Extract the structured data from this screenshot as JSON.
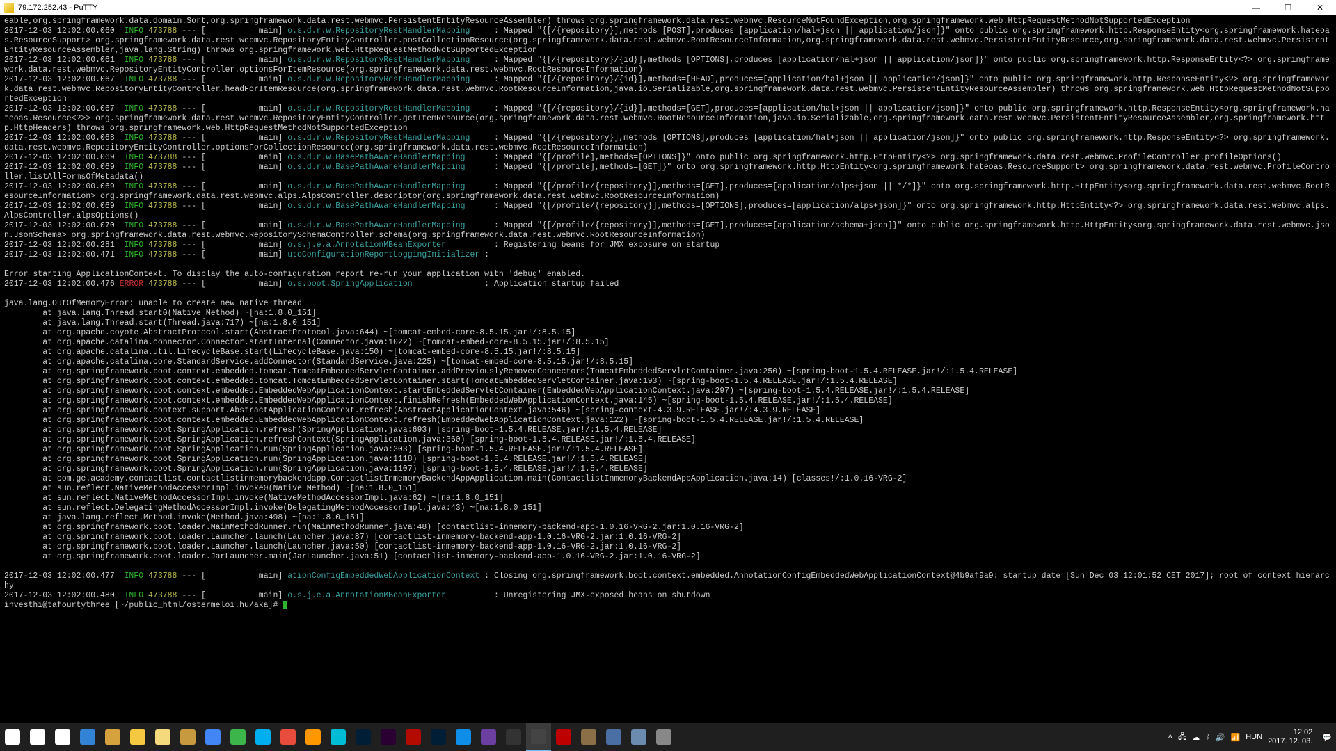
{
  "titlebar": {
    "title": "79.172.252.43 - PuTTY"
  },
  "lines": [
    {
      "parts": [
        {
          "t": "eable,org.springframework.data.domain.Sort,org.springframework.data.rest.webmvc.PersistentEntityResourceAssembler) throws org.springframework.data.rest.webmvc.ResourceNotFoundException,org.springframework.web.HttpRequestMethodNotSupportedException"
        }
      ]
    },
    {
      "parts": [
        {
          "t": "2017-12-03 12:02:00.060  "
        },
        {
          "t": "INFO",
          "c": "green"
        },
        {
          "t": " "
        },
        {
          "t": "473788",
          "c": "yellowish"
        },
        {
          "t": " --- [           main] "
        },
        {
          "t": "o.s.d.r.w.RepositoryRestHandlerMapping",
          "c": "cyan"
        },
        {
          "t": "     : Mapped \"{[/{repository}],methods=[POST],produces=[application/hal+json || application/json]}\" onto public org.springframework.http.ResponseEntity<org.springframework.hateoas.ResourceSupport> org.springframework.data.rest.webmvc.RepositoryEntityController.postCollectionResource(org.springframework.data.rest.webmvc.RootResourceInformation,org.springframework.data.rest.webmvc.PersistentEntityResource,org.springframework.data.rest.webmvc.PersistentEntityResourceAssembler,java.lang.String) throws org.springframework.web.HttpRequestMethodNotSupportedException"
        }
      ]
    },
    {
      "parts": [
        {
          "t": "2017-12-03 12:02:00.061  "
        },
        {
          "t": "INFO",
          "c": "green"
        },
        {
          "t": " "
        },
        {
          "t": "473788",
          "c": "yellowish"
        },
        {
          "t": " --- [           main] "
        },
        {
          "t": "o.s.d.r.w.RepositoryRestHandlerMapping",
          "c": "cyan"
        },
        {
          "t": "     : Mapped \"{[/{repository}/{id}],methods=[OPTIONS],produces=[application/hal+json || application/json]}\" onto public org.springframework.http.ResponseEntity<?> org.springframework.data.rest.webmvc.RepositoryEntityController.optionsForItemResource(org.springframework.data.rest.webmvc.RootResourceInformation)"
        }
      ]
    },
    {
      "parts": [
        {
          "t": "2017-12-03 12:02:00.067  "
        },
        {
          "t": "INFO",
          "c": "green"
        },
        {
          "t": " "
        },
        {
          "t": "473788",
          "c": "yellowish"
        },
        {
          "t": " --- [           main] "
        },
        {
          "t": "o.s.d.r.w.RepositoryRestHandlerMapping",
          "c": "cyan"
        },
        {
          "t": "     : Mapped \"{[/{repository}/{id}],methods=[HEAD],produces=[application/hal+json || application/json]}\" onto public org.springframework.http.ResponseEntity<?> org.springframework.data.rest.webmvc.RepositoryEntityController.headForItemResource(org.springframework.data.rest.webmvc.RootResourceInformation,java.io.Serializable,org.springframework.data.rest.webmvc.PersistentEntityResourceAssembler) throws org.springframework.web.HttpRequestMethodNotSupportedException"
        }
      ]
    },
    {
      "parts": [
        {
          "t": "2017-12-03 12:02:00.067  "
        },
        {
          "t": "INFO",
          "c": "green"
        },
        {
          "t": " "
        },
        {
          "t": "473788",
          "c": "yellowish"
        },
        {
          "t": " --- [           main] "
        },
        {
          "t": "o.s.d.r.w.RepositoryRestHandlerMapping",
          "c": "cyan"
        },
        {
          "t": "     : Mapped \"{[/{repository}/{id}],methods=[GET],produces=[application/hal+json || application/json]}\" onto public org.springframework.http.ResponseEntity<org.springframework.hateoas.Resource<?>> org.springframework.data.rest.webmvc.RepositoryEntityController.getItemResource(org.springframework.data.rest.webmvc.RootResourceInformation,java.io.Serializable,org.springframework.data.rest.webmvc.PersistentEntityResourceAssembler,org.springframework.http.HttpHeaders) throws org.springframework.web.HttpRequestMethodNotSupportedException"
        }
      ]
    },
    {
      "parts": [
        {
          "t": "2017-12-03 12:02:00.068  "
        },
        {
          "t": "INFO",
          "c": "green"
        },
        {
          "t": " "
        },
        {
          "t": "473788",
          "c": "yellowish"
        },
        {
          "t": " --- [           main] "
        },
        {
          "t": "o.s.d.r.w.RepositoryRestHandlerMapping",
          "c": "cyan"
        },
        {
          "t": "     : Mapped \"{[/{repository}],methods=[OPTIONS],produces=[application/hal+json || application/json]}\" onto public org.springframework.http.ResponseEntity<?> org.springframework.data.rest.webmvc.RepositoryEntityController.optionsForCollectionResource(org.springframework.data.rest.webmvc.RootResourceInformation)"
        }
      ]
    },
    {
      "parts": [
        {
          "t": "2017-12-03 12:02:00.069  "
        },
        {
          "t": "INFO",
          "c": "green"
        },
        {
          "t": " "
        },
        {
          "t": "473788",
          "c": "yellowish"
        },
        {
          "t": " --- [           main] "
        },
        {
          "t": "o.s.d.r.w.BasePathAwareHandlerMapping",
          "c": "cyan"
        },
        {
          "t": "      : Mapped \"{[/profile],methods=[OPTIONS]}\" onto public org.springframework.http.HttpEntity<?> org.springframework.data.rest.webmvc.ProfileController.profileOptions()"
        }
      ]
    },
    {
      "parts": [
        {
          "t": "2017-12-03 12:02:00.069  "
        },
        {
          "t": "INFO",
          "c": "green"
        },
        {
          "t": " "
        },
        {
          "t": "473788",
          "c": "yellowish"
        },
        {
          "t": " --- [           main] "
        },
        {
          "t": "o.s.d.r.w.BasePathAwareHandlerMapping",
          "c": "cyan"
        },
        {
          "t": "      : Mapped \"{[/profile],methods=[GET]}\" onto org.springframework.http.HttpEntity<org.springframework.hateoas.ResourceSupport> org.springframework.data.rest.webmvc.ProfileController.listAllFormsOfMetadata()"
        }
      ]
    },
    {
      "parts": [
        {
          "t": "2017-12-03 12:02:00.069  "
        },
        {
          "t": "INFO",
          "c": "green"
        },
        {
          "t": " "
        },
        {
          "t": "473788",
          "c": "yellowish"
        },
        {
          "t": " --- [           main] "
        },
        {
          "t": "o.s.d.r.w.BasePathAwareHandlerMapping",
          "c": "cyan"
        },
        {
          "t": "      : Mapped \"{[/profile/{repository}],methods=[GET],produces=[application/alps+json || */*]}\" onto org.springframework.http.HttpEntity<org.springframework.data.rest.webmvc.RootResourceInformation> org.springframework.data.rest.webmvc.alps.AlpsController.descriptor(org.springframework.data.rest.webmvc.RootResourceInformation)"
        }
      ]
    },
    {
      "parts": [
        {
          "t": "2017-12-03 12:02:00.069  "
        },
        {
          "t": "INFO",
          "c": "green"
        },
        {
          "t": " "
        },
        {
          "t": "473788",
          "c": "yellowish"
        },
        {
          "t": " --- [           main] "
        },
        {
          "t": "o.s.d.r.w.BasePathAwareHandlerMapping",
          "c": "cyan"
        },
        {
          "t": "      : Mapped \"{[/profile/{repository}],methods=[OPTIONS],produces=[application/alps+json]}\" onto org.springframework.http.HttpEntity<?> org.springframework.data.rest.webmvc.alps.AlpsController.alpsOptions()"
        }
      ]
    },
    {
      "parts": [
        {
          "t": "2017-12-03 12:02:00.070  "
        },
        {
          "t": "INFO",
          "c": "green"
        },
        {
          "t": " "
        },
        {
          "t": "473788",
          "c": "yellowish"
        },
        {
          "t": " --- [           main] "
        },
        {
          "t": "o.s.d.r.w.BasePathAwareHandlerMapping",
          "c": "cyan"
        },
        {
          "t": "      : Mapped \"{[/profile/{repository}],methods=[GET],produces=[application/schema+json]}\" onto public org.springframework.http.HttpEntity<org.springframework.data.rest.webmvc.json.JsonSchema> org.springframework.data.rest.webmvc.RepositorySchemaController.schema(org.springframework.data.rest.webmvc.RootResourceInformation)"
        }
      ]
    },
    {
      "parts": [
        {
          "t": "2017-12-03 12:02:00.281  "
        },
        {
          "t": "INFO",
          "c": "green"
        },
        {
          "t": " "
        },
        {
          "t": "473788",
          "c": "yellowish"
        },
        {
          "t": " --- [           main] "
        },
        {
          "t": "o.s.j.e.a.AnnotationMBeanExporter",
          "c": "cyan"
        },
        {
          "t": "          : Registering beans for JMX exposure on startup"
        }
      ]
    },
    {
      "parts": [
        {
          "t": "2017-12-03 12:02:00.471  "
        },
        {
          "t": "INFO",
          "c": "green"
        },
        {
          "t": " "
        },
        {
          "t": "473788",
          "c": "yellowish"
        },
        {
          "t": " --- [           main] "
        },
        {
          "t": "utoConfigurationReportLoggingInitializer",
          "c": "cyan"
        },
        {
          "t": " : "
        }
      ]
    },
    {
      "parts": [
        {
          "t": " "
        }
      ]
    },
    {
      "parts": [
        {
          "t": "Error starting ApplicationContext. To display the auto-configuration report re-run your application with 'debug' enabled."
        }
      ]
    },
    {
      "parts": [
        {
          "t": "2017-12-03 12:02:00.476 "
        },
        {
          "t": "ERROR",
          "c": "red"
        },
        {
          "t": " "
        },
        {
          "t": "473788",
          "c": "yellowish"
        },
        {
          "t": " --- [           main] "
        },
        {
          "t": "o.s.boot.SpringApplication",
          "c": "cyan"
        },
        {
          "t": "               : Application startup failed"
        }
      ]
    },
    {
      "parts": [
        {
          "t": " "
        }
      ]
    },
    {
      "parts": [
        {
          "t": "java.lang.OutOfMemoryError: unable to create new native thread"
        }
      ]
    },
    {
      "parts": [
        {
          "t": "        at java.lang.Thread.start0(Native Method) ~[na:1.8.0_151]"
        }
      ]
    },
    {
      "parts": [
        {
          "t": "        at java.lang.Thread.start(Thread.java:717) ~[na:1.8.0_151]"
        }
      ]
    },
    {
      "parts": [
        {
          "t": "        at org.apache.coyote.AbstractProtocol.start(AbstractProtocol.java:644) ~[tomcat-embed-core-8.5.15.jar!/:8.5.15]"
        }
      ]
    },
    {
      "parts": [
        {
          "t": "        at org.apache.catalina.connector.Connector.startInternal(Connector.java:1022) ~[tomcat-embed-core-8.5.15.jar!/:8.5.15]"
        }
      ]
    },
    {
      "parts": [
        {
          "t": "        at org.apache.catalina.util.LifecycleBase.start(LifecycleBase.java:150) ~[tomcat-embed-core-8.5.15.jar!/:8.5.15]"
        }
      ]
    },
    {
      "parts": [
        {
          "t": "        at org.apache.catalina.core.StandardService.addConnector(StandardService.java:225) ~[tomcat-embed-core-8.5.15.jar!/:8.5.15]"
        }
      ]
    },
    {
      "parts": [
        {
          "t": "        at org.springframework.boot.context.embedded.tomcat.TomcatEmbeddedServletContainer.addPreviouslyRemovedConnectors(TomcatEmbeddedServletContainer.java:250) ~[spring-boot-1.5.4.RELEASE.jar!/:1.5.4.RELEASE]"
        }
      ]
    },
    {
      "parts": [
        {
          "t": "        at org.springframework.boot.context.embedded.tomcat.TomcatEmbeddedServletContainer.start(TomcatEmbeddedServletContainer.java:193) ~[spring-boot-1.5.4.RELEASE.jar!/:1.5.4.RELEASE]"
        }
      ]
    },
    {
      "parts": [
        {
          "t": "        at org.springframework.boot.context.embedded.EmbeddedWebApplicationContext.startEmbeddedServletContainer(EmbeddedWebApplicationContext.java:297) ~[spring-boot-1.5.4.RELEASE.jar!/:1.5.4.RELEASE]"
        }
      ]
    },
    {
      "parts": [
        {
          "t": "        at org.springframework.boot.context.embedded.EmbeddedWebApplicationContext.finishRefresh(EmbeddedWebApplicationContext.java:145) ~[spring-boot-1.5.4.RELEASE.jar!/:1.5.4.RELEASE]"
        }
      ]
    },
    {
      "parts": [
        {
          "t": "        at org.springframework.context.support.AbstractApplicationContext.refresh(AbstractApplicationContext.java:546) ~[spring-context-4.3.9.RELEASE.jar!/:4.3.9.RELEASE]"
        }
      ]
    },
    {
      "parts": [
        {
          "t": "        at org.springframework.boot.context.embedded.EmbeddedWebApplicationContext.refresh(EmbeddedWebApplicationContext.java:122) ~[spring-boot-1.5.4.RELEASE.jar!/:1.5.4.RELEASE]"
        }
      ]
    },
    {
      "parts": [
        {
          "t": "        at org.springframework.boot.SpringApplication.refresh(SpringApplication.java:693) [spring-boot-1.5.4.RELEASE.jar!/:1.5.4.RELEASE]"
        }
      ]
    },
    {
      "parts": [
        {
          "t": "        at org.springframework.boot.SpringApplication.refreshContext(SpringApplication.java:360) [spring-boot-1.5.4.RELEASE.jar!/:1.5.4.RELEASE]"
        }
      ]
    },
    {
      "parts": [
        {
          "t": "        at org.springframework.boot.SpringApplication.run(SpringApplication.java:303) [spring-boot-1.5.4.RELEASE.jar!/:1.5.4.RELEASE]"
        }
      ]
    },
    {
      "parts": [
        {
          "t": "        at org.springframework.boot.SpringApplication.run(SpringApplication.java:1118) [spring-boot-1.5.4.RELEASE.jar!/:1.5.4.RELEASE]"
        }
      ]
    },
    {
      "parts": [
        {
          "t": "        at org.springframework.boot.SpringApplication.run(SpringApplication.java:1107) [spring-boot-1.5.4.RELEASE.jar!/:1.5.4.RELEASE]"
        }
      ]
    },
    {
      "parts": [
        {
          "t": "        at com.ge.academy.contactlist.contactlistinmemorybackendapp.ContactlistInmemoryBackendAppApplication.main(ContactlistInmemoryBackendAppApplication.java:14) [classes!/:1.0.16-VRG-2]"
        }
      ]
    },
    {
      "parts": [
        {
          "t": "        at sun.reflect.NativeMethodAccessorImpl.invoke0(Native Method) ~[na:1.8.0_151]"
        }
      ]
    },
    {
      "parts": [
        {
          "t": "        at sun.reflect.NativeMethodAccessorImpl.invoke(NativeMethodAccessorImpl.java:62) ~[na:1.8.0_151]"
        }
      ]
    },
    {
      "parts": [
        {
          "t": "        at sun.reflect.DelegatingMethodAccessorImpl.invoke(DelegatingMethodAccessorImpl.java:43) ~[na:1.8.0_151]"
        }
      ]
    },
    {
      "parts": [
        {
          "t": "        at java.lang.reflect.Method.invoke(Method.java:498) ~[na:1.8.0_151]"
        }
      ]
    },
    {
      "parts": [
        {
          "t": "        at org.springframework.boot.loader.MainMethodRunner.run(MainMethodRunner.java:48) [contactlist-inmemory-backend-app-1.0.16-VRG-2.jar:1.0.16-VRG-2]"
        }
      ]
    },
    {
      "parts": [
        {
          "t": "        at org.springframework.boot.loader.Launcher.launch(Launcher.java:87) [contactlist-inmemory-backend-app-1.0.16-VRG-2.jar:1.0.16-VRG-2]"
        }
      ]
    },
    {
      "parts": [
        {
          "t": "        at org.springframework.boot.loader.Launcher.launch(Launcher.java:50) [contactlist-inmemory-backend-app-1.0.16-VRG-2.jar:1.0.16-VRG-2]"
        }
      ]
    },
    {
      "parts": [
        {
          "t": "        at org.springframework.boot.loader.JarLauncher.main(JarLauncher.java:51) [contactlist-inmemory-backend-app-1.0.16-VRG-2.jar:1.0.16-VRG-2]"
        }
      ]
    },
    {
      "parts": [
        {
          "t": " "
        }
      ]
    },
    {
      "parts": [
        {
          "t": "2017-12-03 12:02:00.477  "
        },
        {
          "t": "INFO",
          "c": "green"
        },
        {
          "t": " "
        },
        {
          "t": "473788",
          "c": "yellowish"
        },
        {
          "t": " --- [           main] "
        },
        {
          "t": "ationConfigEmbeddedWebApplicationContext",
          "c": "cyan"
        },
        {
          "t": " : Closing org.springframework.boot.context.embedded.AnnotationConfigEmbeddedWebApplicationContext@4b9af9a9: startup date [Sun Dec 03 12:01:52 CET 2017]; root of context hierarchy"
        }
      ]
    },
    {
      "parts": [
        {
          "t": "2017-12-03 12:02:00.480  "
        },
        {
          "t": "INFO",
          "c": "green"
        },
        {
          "t": " "
        },
        {
          "t": "473788",
          "c": "yellowish"
        },
        {
          "t": " --- [           main] "
        },
        {
          "t": "o.s.j.e.a.AnnotationMBeanExporter",
          "c": "cyan"
        },
        {
          "t": "          : Unregistering JMX-exposed beans on shutdown"
        }
      ]
    },
    {
      "parts": [
        {
          "t": "investhi@tafourtythree [~/public_html/ostermeloi.hu/aka]# "
        },
        {
          "cursor": true
        }
      ]
    }
  ],
  "taskbar": {
    "apps": [
      {
        "name": "start",
        "color": "#fff"
      },
      {
        "name": "search",
        "color": "#fff"
      },
      {
        "name": "taskview",
        "color": "#fff"
      },
      {
        "name": "edge",
        "color": "#3282d6"
      },
      {
        "name": "store",
        "color": "#d6a23d"
      },
      {
        "name": "explorer",
        "color": "#f5c842"
      },
      {
        "name": "notepad",
        "color": "#f5d97d"
      },
      {
        "name": "explorer2",
        "color": "#c79a40"
      },
      {
        "name": "chrome",
        "color": "#4285f4"
      },
      {
        "name": "utorrent",
        "color": "#3cb54a"
      },
      {
        "name": "skype",
        "color": "#00aff0"
      },
      {
        "name": "ccleaner",
        "color": "#e74c3c"
      },
      {
        "name": "sublime",
        "color": "#ff9800"
      },
      {
        "name": "app1",
        "color": "#00bcd4"
      },
      {
        "name": "lightroom",
        "color": "#001e36"
      },
      {
        "name": "premiere",
        "color": "#2a0033"
      },
      {
        "name": "acrobat",
        "color": "#b30b00"
      },
      {
        "name": "photoshop",
        "color": "#001e36"
      },
      {
        "name": "teamviewer",
        "color": "#0e8ee9"
      },
      {
        "name": "intellij",
        "color": "#6b3fa0"
      },
      {
        "name": "cmd",
        "color": "#333"
      },
      {
        "name": "putty",
        "color": "#444",
        "active": true
      },
      {
        "name": "filezilla",
        "color": "#bf0000"
      },
      {
        "name": "app2",
        "color": "#8b6f47"
      },
      {
        "name": "app3",
        "color": "#4a6fa5"
      },
      {
        "name": "app4",
        "color": "#6b8caf"
      },
      {
        "name": "app5",
        "color": "#888"
      }
    ]
  },
  "tray": {
    "lang": "HUN",
    "time": "12:02",
    "date": "2017. 12. 03."
  }
}
